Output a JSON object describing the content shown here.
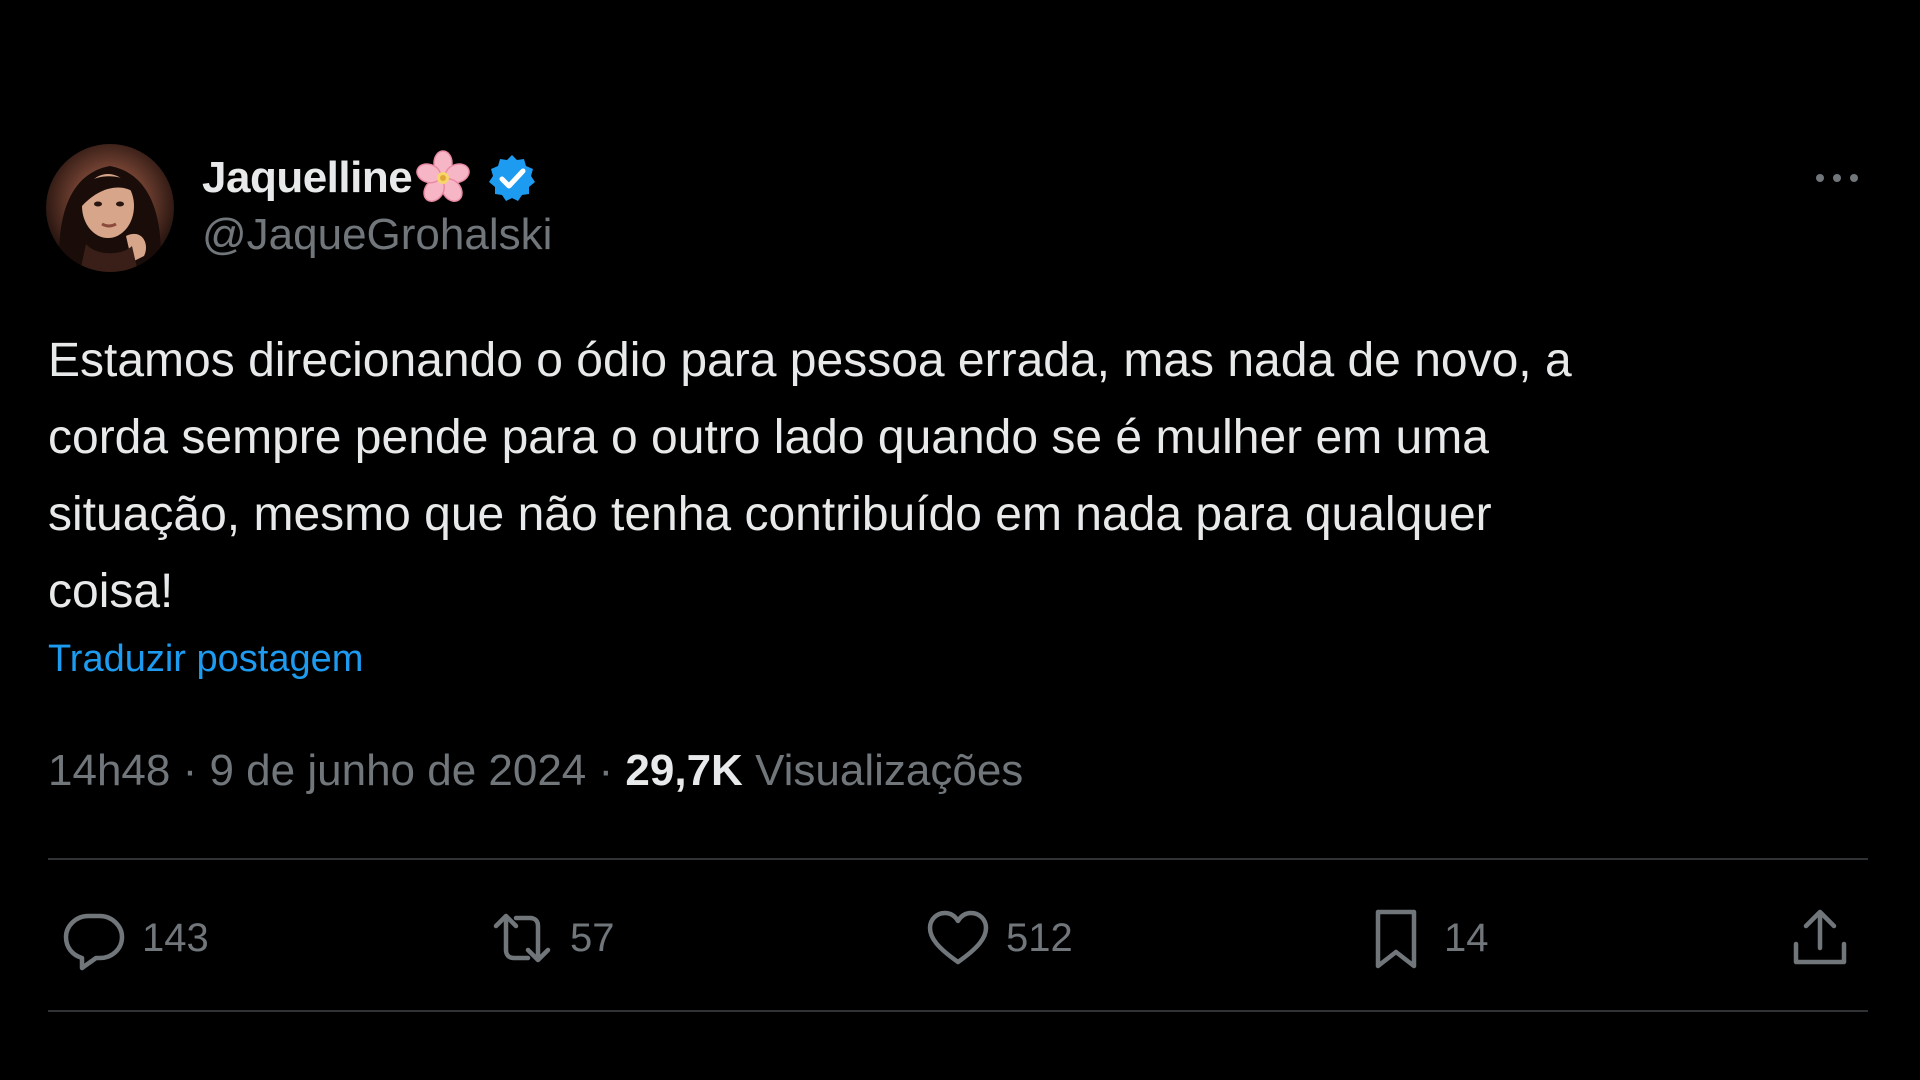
{
  "author": {
    "display_name": "Jaquelline",
    "handle": "@JaqueGrohalski",
    "verified": true,
    "emoji_icon": "cherry-blossom-icon",
    "verified_color": "#1d9bf0"
  },
  "tweet": {
    "text": "Estamos direcionando o ódio para pessoa errada, mas nada de novo, a\ncorda sempre pende para o outro lado quando se é mulher em uma\nsituação, mesmo que não tenha contribuído em nada para qualquer\ncoisa!",
    "translate_label": "Traduzir postagem"
  },
  "meta": {
    "time": "14h48",
    "separator": "·",
    "date": "9 de junho de 2024",
    "views_count": "29,7K",
    "views_label": "Visualizações"
  },
  "actions": {
    "replies": "143",
    "reposts": "57",
    "likes": "512",
    "bookmarks": "14"
  },
  "colors": {
    "background": "#000000",
    "text_primary": "#e7e9ea",
    "text_secondary": "#71767b",
    "link": "#1d9bf0",
    "divider": "#2f3336"
  }
}
